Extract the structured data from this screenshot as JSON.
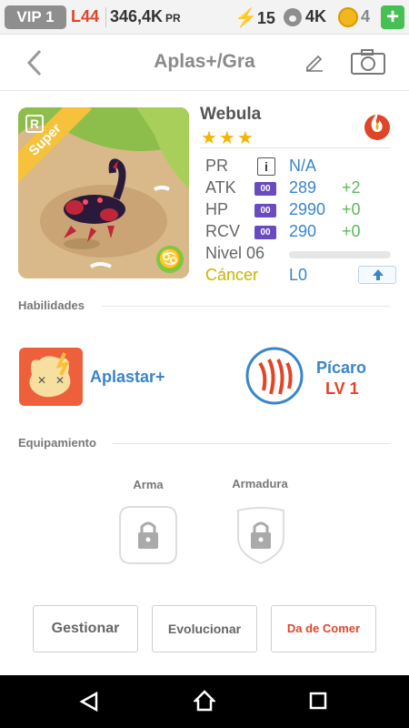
{
  "topbar": {
    "vip": "VIP 1",
    "level": "L44",
    "power": "346,4K",
    "power_unit": "PR",
    "energy": "15",
    "paw_count": "4K",
    "coins": "4",
    "plus": "+"
  },
  "header": {
    "title": "Aplas+/Gra"
  },
  "pet": {
    "name": "Webula",
    "stars": "★★★",
    "rank": "R",
    "rarity": "Super",
    "zodiac_symbol": "♋",
    "stats": {
      "pr_label": "PR",
      "pr_info": "i",
      "pr_value": "N/A",
      "atk_label": "ATK",
      "atk_badge": "00",
      "atk_value": "289",
      "atk_bonus": "+2",
      "hp_label": "HP",
      "hp_badge": "00",
      "hp_value": "2990",
      "hp_bonus": "+0",
      "rcv_label": "RCV",
      "rcv_badge": "00",
      "rcv_value": "290",
      "rcv_bonus": "+0",
      "level_label": "Nivel 06",
      "level_progress": 0,
      "zodiac_label": "Cáncer",
      "zodiac_level": "L0"
    }
  },
  "abilities": {
    "section_title": "Habilidades",
    "skill_name": "Aplastar+",
    "class_name": "Pícaro",
    "class_level": "LV 1"
  },
  "equipment": {
    "section_title": "Equipamiento",
    "weapon_label": "Arma",
    "armor_label": "Armadura"
  },
  "buttons": {
    "manage": "Gestionar",
    "evolve": "Evolucionar",
    "feed": "Da de Comer"
  },
  "colors": {
    "accent_blue": "#3a85c9",
    "accent_red": "#e0452a",
    "bonus_green": "#5db85a",
    "rarity_yellow": "#f6c23b"
  }
}
